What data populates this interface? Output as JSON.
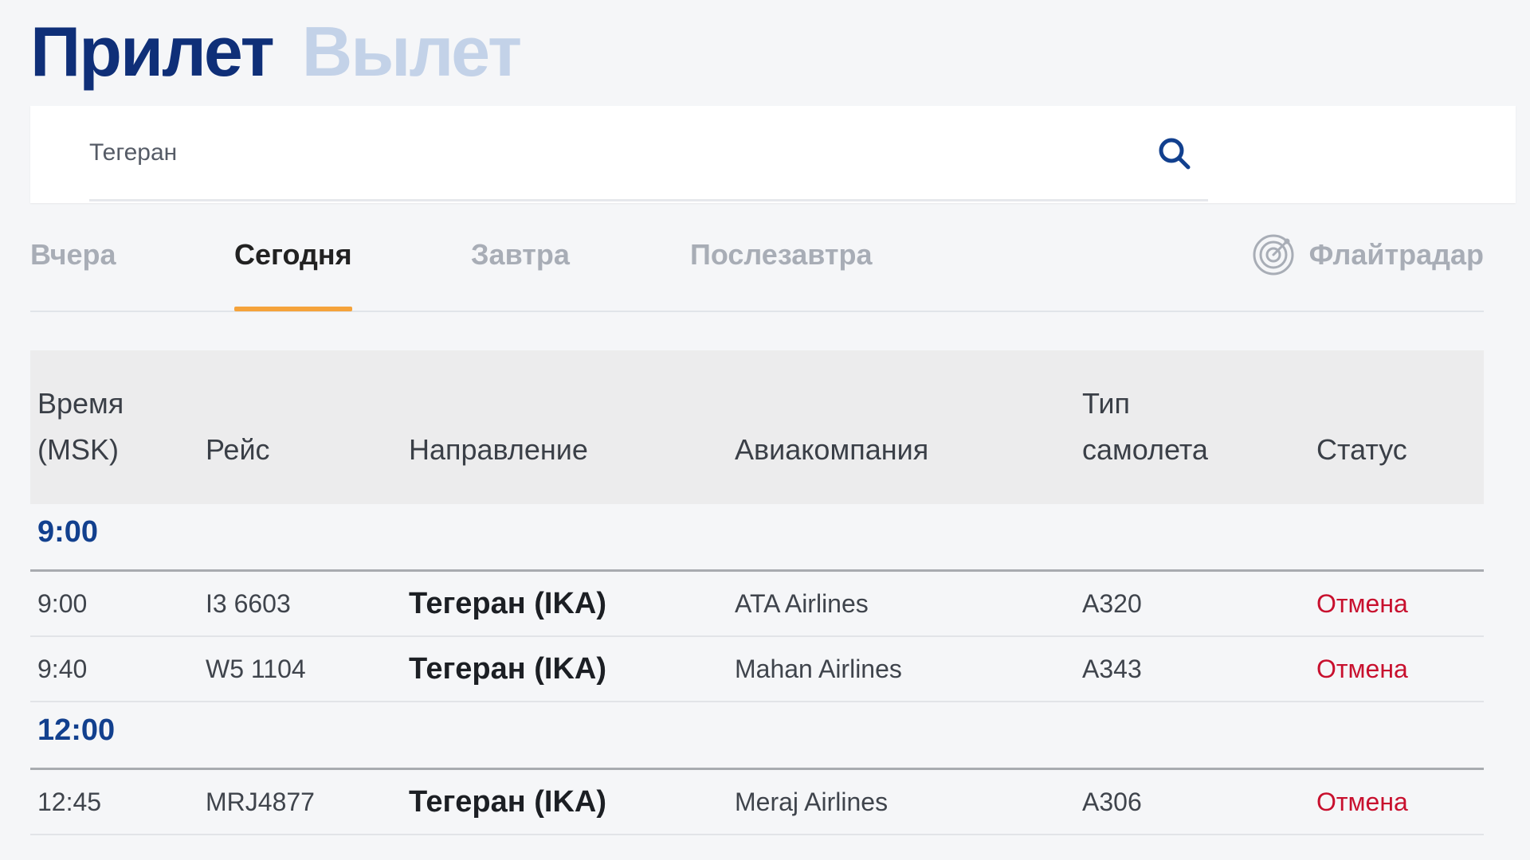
{
  "header": {
    "tabs": [
      {
        "label": "Прилет",
        "active": true
      },
      {
        "label": "Вылет",
        "active": false
      }
    ]
  },
  "search": {
    "value": "Тегеран",
    "icon": "search-icon"
  },
  "day_tabs": {
    "items": [
      {
        "label": "Вчера",
        "active": false
      },
      {
        "label": "Сегодня",
        "active": true
      },
      {
        "label": "Завтра",
        "active": false
      },
      {
        "label": "Послезавтра",
        "active": false
      }
    ],
    "radar": {
      "label": "Флайтрадар",
      "icon": "radar-icon"
    }
  },
  "table": {
    "columns": {
      "time_line1": "Время",
      "time_line2": "(MSK)",
      "flight": "Рейс",
      "direction": "Направление",
      "airline": "Авиакомпания",
      "type_line1": "Тип",
      "type_line2": "самолета",
      "status": "Статус"
    },
    "groups": [
      {
        "label": "9:00",
        "rows": [
          {
            "time": "9:00",
            "flight": "I3 6603",
            "direction": "Тегеран (IKA)",
            "airline": "ATA Airlines",
            "aircraft": "A320",
            "status": "Отмена"
          },
          {
            "time": "9:40",
            "flight": "W5 1104",
            "direction": "Тегеран (IKA)",
            "airline": "Mahan Airlines",
            "aircraft": "A343",
            "status": "Отмена"
          }
        ]
      },
      {
        "label": "12:00",
        "rows": [
          {
            "time": "12:45",
            "flight": "MRJ4877",
            "direction": "Тегеран (IKA)",
            "airline": "Meraj Airlines",
            "aircraft": "A306",
            "status": "Отмена"
          }
        ]
      }
    ]
  },
  "colors": {
    "title_active": "#0f2f78",
    "title_inactive": "#c3d2e8",
    "group_label": "#12408e",
    "tab_underline": "#f5a33b",
    "status_cancel": "#c8102e"
  }
}
